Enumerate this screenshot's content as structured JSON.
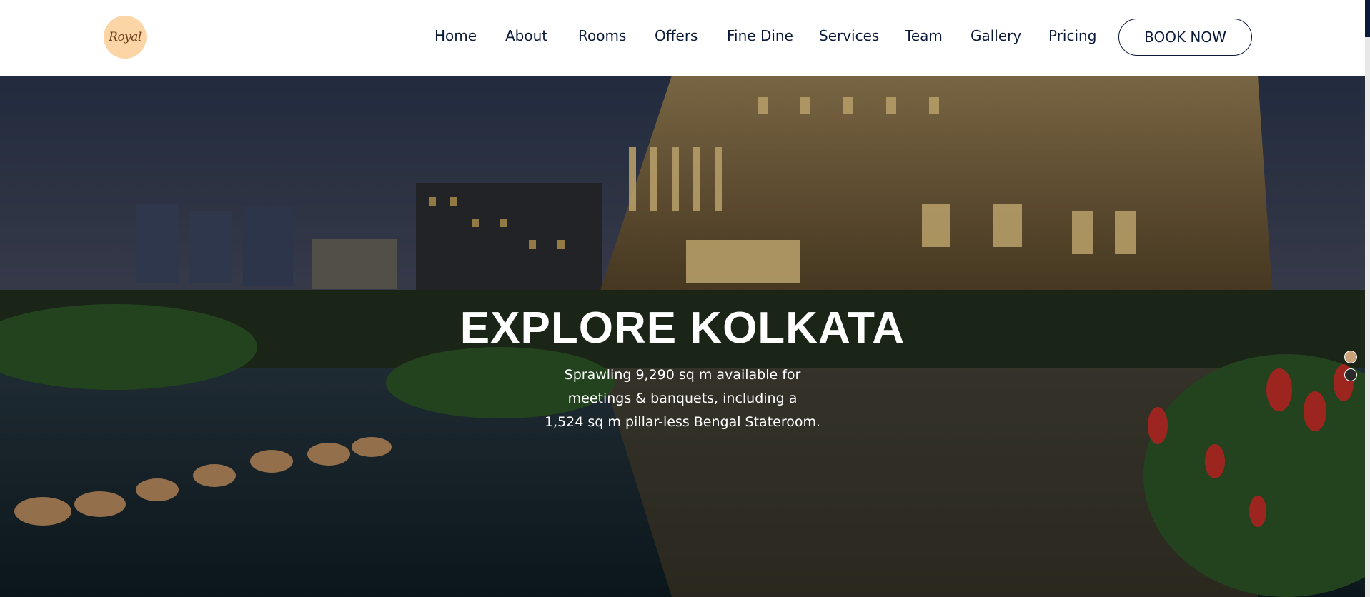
{
  "header": {
    "logo_text": "Royal",
    "nav": [
      {
        "label": "Home"
      },
      {
        "label": "About"
      },
      {
        "label": "Rooms"
      },
      {
        "label": "Offers"
      },
      {
        "label": "Fine Dine"
      },
      {
        "label": "Services"
      },
      {
        "label": "Team"
      },
      {
        "label": "Gallery"
      },
      {
        "label": "Pricing"
      }
    ],
    "book_label": "BOOK NOW"
  },
  "hero": {
    "title": "EXPLORE KOLKATA",
    "lines": [
      "Sprawling 9,290 sq m available for",
      "meetings & banquets, including a",
      "1,524 sq m pillar-less Bengal Stateroom."
    ],
    "slides": [
      {
        "active": true
      },
      {
        "active": false
      }
    ]
  },
  "colors": {
    "navy": "#0c1a3a",
    "logo_bg": "#fcd5a6",
    "dot_active": "#c9a27a"
  }
}
